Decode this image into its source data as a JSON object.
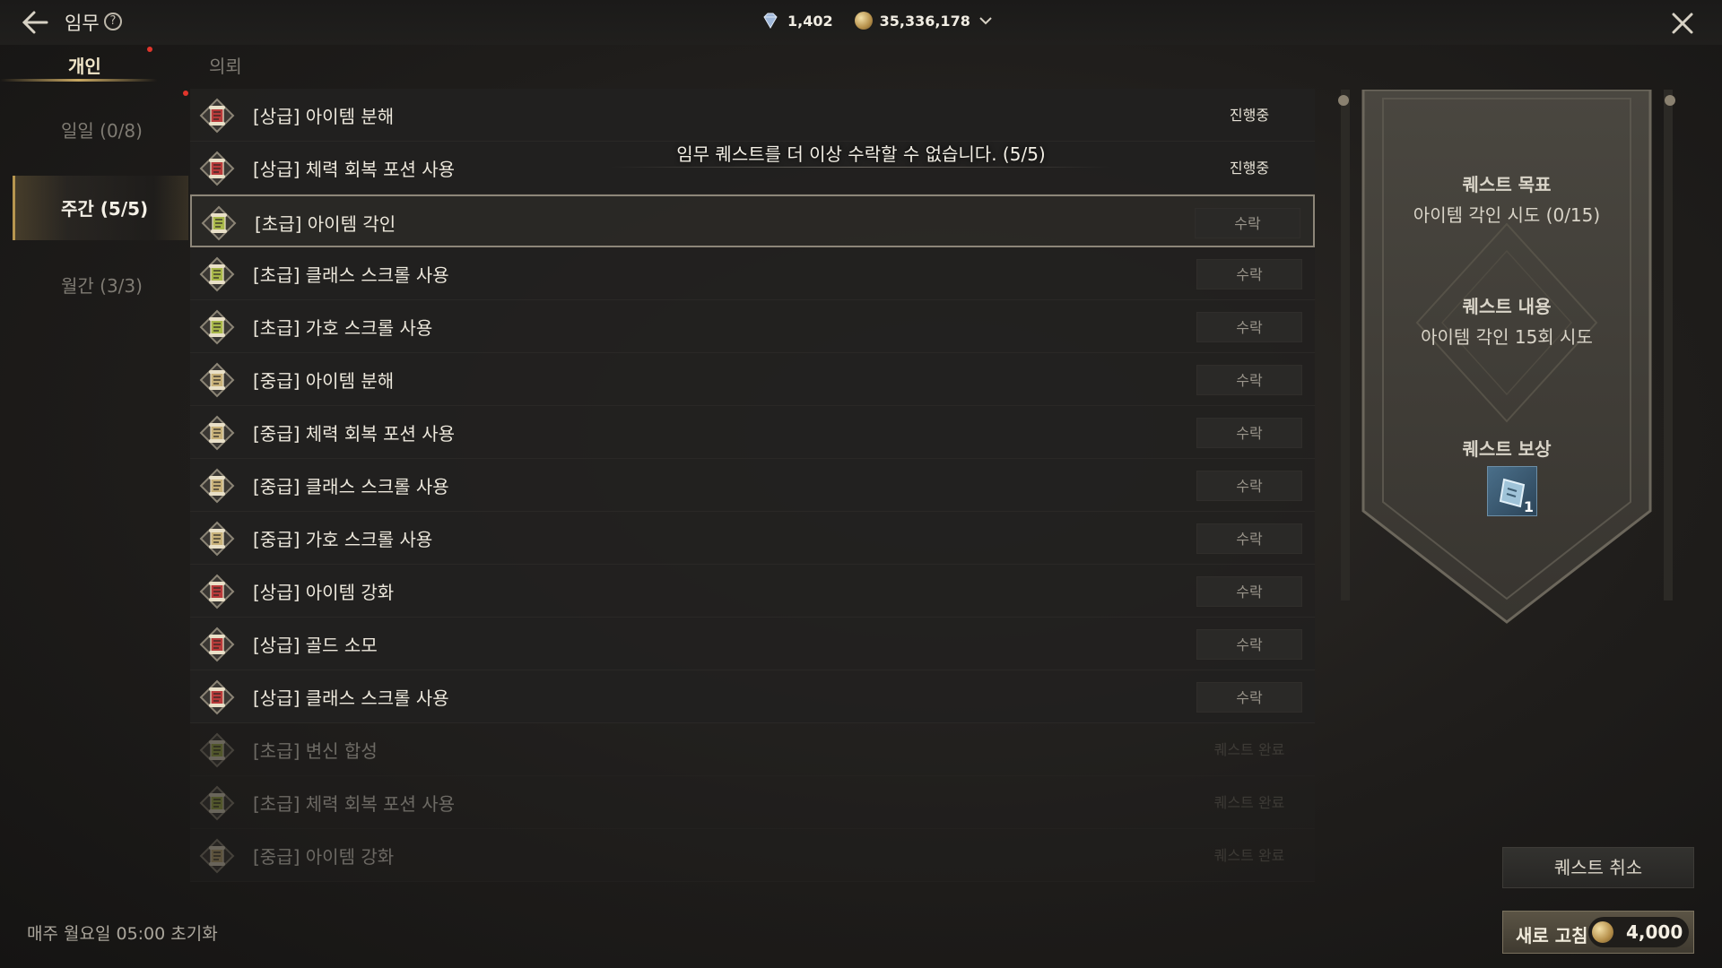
{
  "header": {
    "title": "임무",
    "gems": "1,402",
    "gold": "35,336,178"
  },
  "tabs": [
    {
      "label": "개인",
      "active": true
    },
    {
      "label": "의뢰",
      "active": false
    }
  ],
  "side_menu": [
    {
      "label": "일일 (0/8)",
      "active": false
    },
    {
      "label": "주간 (5/5)",
      "active": true
    },
    {
      "label": "월간 (3/3)",
      "active": false
    }
  ],
  "notice": "임무 퀘스트를 더 이상 수락할 수 없습니다. (5/5)",
  "quests": [
    {
      "name": "[상급] 아이템 분해",
      "status": "진행중",
      "tier": "high",
      "state": "in-progress"
    },
    {
      "name": "[상급] 체력 회복 포션 사용",
      "status": "진행중",
      "tier": "high",
      "state": "in-progress"
    },
    {
      "name": "[초급] 아이템 각인",
      "status": "수락",
      "tier": "low",
      "state": "selected"
    },
    {
      "name": "[초급] 클래스 스크롤 사용",
      "status": "수락",
      "tier": "low",
      "state": "available"
    },
    {
      "name": "[초급] 가호 스크롤 사용",
      "status": "수락",
      "tier": "low",
      "state": "available"
    },
    {
      "name": "[중급] 아이템 분해",
      "status": "수락",
      "tier": "mid",
      "state": "available"
    },
    {
      "name": "[중급] 체력 회복 포션 사용",
      "status": "수락",
      "tier": "mid",
      "state": "available"
    },
    {
      "name": "[중급] 클래스 스크롤 사용",
      "status": "수락",
      "tier": "mid",
      "state": "available"
    },
    {
      "name": "[중급] 가호 스크롤 사용",
      "status": "수락",
      "tier": "mid",
      "state": "available"
    },
    {
      "name": "[상급] 아이템 강화",
      "status": "수락",
      "tier": "high",
      "state": "available"
    },
    {
      "name": "[상급] 골드 소모",
      "status": "수락",
      "tier": "high",
      "state": "available"
    },
    {
      "name": "[상급] 클래스 스크롤 사용",
      "status": "수락",
      "tier": "high",
      "state": "available"
    },
    {
      "name": "[초급] 변신 합성",
      "status": "퀘스트 완료",
      "tier": "low",
      "state": "completed"
    },
    {
      "name": "[초급] 체력 회복 포션 사용",
      "status": "퀘스트 완료",
      "tier": "low",
      "state": "completed"
    },
    {
      "name": "[중급] 아이템 강화",
      "status": "퀘스트 완료",
      "tier": "mid",
      "state": "completed"
    }
  ],
  "tier_colors": {
    "high": "#b83a3a",
    "mid": "#c9b27a",
    "low": "#a9b84a"
  },
  "detail": {
    "goal_heading": "퀘스트 목표",
    "goal_value": "아이템 각인 시도 (0/15)",
    "content_heading": "퀘스트 내용",
    "content_value": "아이템 각인 15회 시도",
    "reward_heading": "퀘스트 보상",
    "reward_count": "1"
  },
  "footer": {
    "reset_text": "매주 월요일 05:00 초기화",
    "cancel_label": "퀘스트 취소",
    "refresh_label": "새로 고침",
    "refresh_cost": "4,000"
  }
}
